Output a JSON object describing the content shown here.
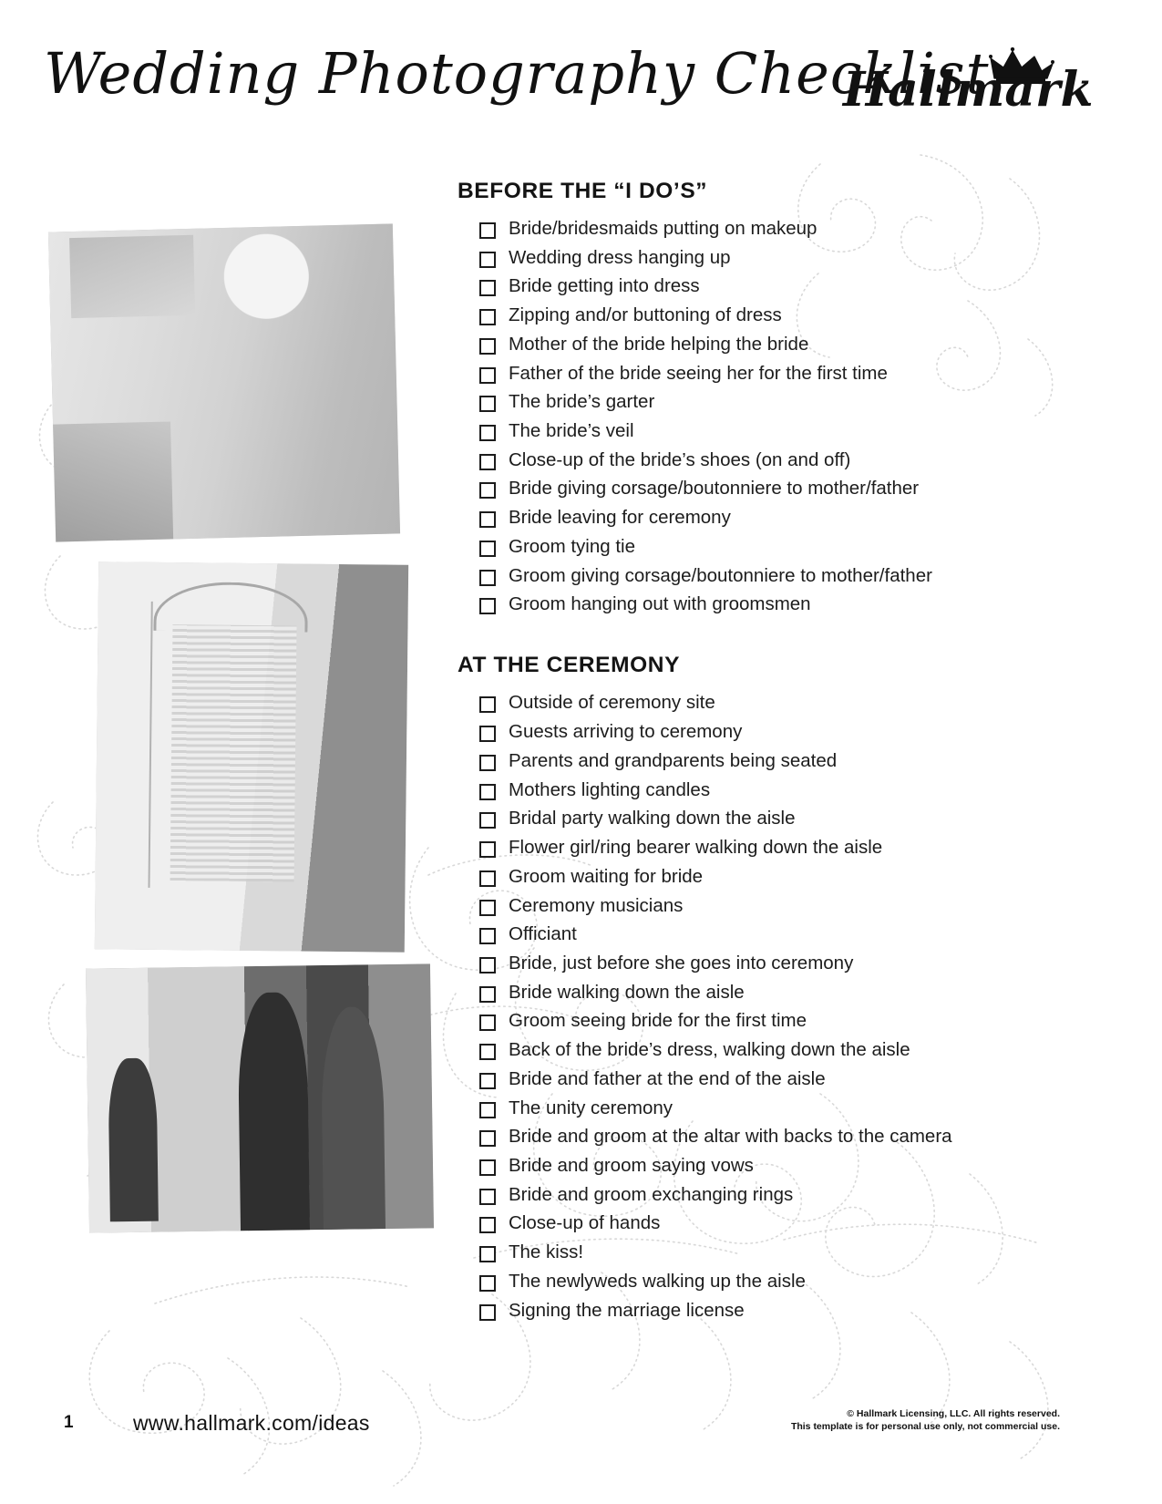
{
  "header": {
    "title": "Wedding Photography Checklist",
    "brand_name": "Hallmark",
    "brand_icon": "crown-icon"
  },
  "photos": [
    {
      "name": "photo-bride-getting-ready",
      "alt": "Bride getting ready"
    },
    {
      "name": "photo-wedding-dress-hanging",
      "alt": "Wedding dress hanging up"
    },
    {
      "name": "photo-ceremony-moment",
      "alt": "Ceremony moment"
    }
  ],
  "checklist": {
    "sections": [
      {
        "title": "BEFORE THE “I DO’S”",
        "items": [
          "Bride/bridesmaids putting on makeup",
          "Wedding dress hanging up",
          "Bride getting into dress",
          "Zipping and/or buttoning of dress",
          "Mother of the bride helping the bride",
          "Father of the bride seeing her for the first time",
          "The bride’s garter",
          "The bride’s veil",
          "Close-up of the bride’s shoes (on and off)",
          "Bride giving corsage/boutonniere to mother/father",
          "Bride leaving for ceremony",
          "Groom tying tie",
          "Groom giving corsage/boutonniere to mother/father",
          "Groom hanging out with groomsmen"
        ]
      },
      {
        "title": "AT THE CEREMONY",
        "items": [
          "Outside of ceremony site",
          "Guests arriving to ceremony",
          "Parents and grandparents being seated",
          "Mothers lighting candles",
          "Bridal party walking down the aisle",
          "Flower girl/ring bearer walking down the aisle",
          "Groom waiting for bride",
          "Ceremony musicians",
          "Officiant",
          "Bride, just before she goes into ceremony",
          "Bride walking down the aisle",
          "Groom seeing bride for the first time",
          "Back of the bride’s dress, walking down the aisle",
          "Bride and father at the end of the aisle",
          "The unity ceremony",
          "Bride and groom at the altar with backs to the camera",
          "Bride and groom saying vows",
          "Bride and groom exchanging rings",
          "Close-up of hands",
          "The kiss!",
          "The newlyweds walking up the aisle",
          "Signing the marriage license"
        ]
      }
    ]
  },
  "footer": {
    "page_number": "1",
    "url": "www.hallmark.com/ideas",
    "copyright_line_1": "© Hallmark Licensing, LLC. All rights reserved.",
    "copyright_line_2": "This template is for personal use only, not commercial use."
  }
}
